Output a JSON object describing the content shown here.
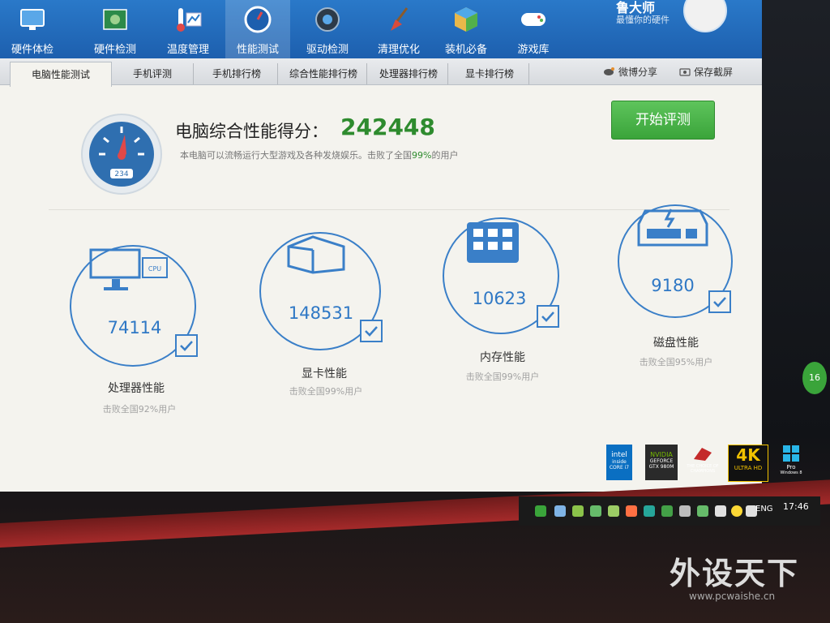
{
  "app": {
    "brand_name": "鲁大师",
    "brand_slogan": "最懂你的硬件"
  },
  "nav": [
    {
      "label": "硬件体检",
      "icon": "monitor-check-icon"
    },
    {
      "label": "硬件检测",
      "icon": "circuit-board-icon"
    },
    {
      "label": "温度管理",
      "icon": "thermometer-icon"
    },
    {
      "label": "性能测试",
      "icon": "speedometer-icon",
      "active": true
    },
    {
      "label": "驱动检测",
      "icon": "driver-gear-icon"
    },
    {
      "label": "清理优化",
      "icon": "broom-icon"
    },
    {
      "label": "装机必备",
      "icon": "cube-icon"
    },
    {
      "label": "游戏库",
      "icon": "gamepad-icon"
    }
  ],
  "tabs": [
    {
      "label": "电脑性能测试",
      "active": true
    },
    {
      "label": "手机评测"
    },
    {
      "label": "手机排行榜"
    },
    {
      "label": "综合性能排行榜"
    },
    {
      "label": "处理器排行榜"
    },
    {
      "label": "显卡排行榜"
    }
  ],
  "share": {
    "weibo": "微博分享",
    "screenshot": "保存截屏"
  },
  "summary": {
    "title": "电脑综合性能得分：",
    "score": "242448",
    "desc_prefix": "本电脑可以流畅运行大型游戏及各种发烧娱乐。击败了全国",
    "desc_pct": "99%",
    "desc_suffix": "的用户",
    "gauge_text": "234",
    "start_button": "开始评测"
  },
  "categories": [
    {
      "name": "处理器性能",
      "value": "74114",
      "sub": "击败全国92%用户",
      "icon": "cpu-monitor-icon"
    },
    {
      "name": "显卡性能",
      "value": "148531",
      "sub": "击败全国99%用户",
      "icon": "gpu-cube-icon"
    },
    {
      "name": "内存性能",
      "value": "10623",
      "sub": "击败全国99%用户",
      "icon": "memory-chip-icon"
    },
    {
      "name": "磁盘性能",
      "value": "9180",
      "sub": "击败全国95%用户",
      "icon": "hard-disk-icon"
    }
  ],
  "badges": {
    "intel": "intel",
    "intel_sub": "inside CORE i7",
    "nvidia": "NVIDIA",
    "nvidia_sub": "GEFORCE GTX 980M",
    "rog": "THE CHOICE OF CHAMPIONS",
    "fourk": "4K",
    "fourk_sub": "ULTRA HD",
    "windows": "Pro",
    "windows_sub": "Windows 8"
  },
  "taskbar": {
    "lang": "ENG",
    "clock": "17:46"
  },
  "edge_badge": "16",
  "watermark": {
    "text": "外设天下",
    "url": "www.pcwaishe.cn"
  },
  "colors": {
    "topbar": "#2a79c9",
    "accent": "#3a7fc8",
    "score_green": "#2e8b2e",
    "button_green": "#4cb54a"
  }
}
